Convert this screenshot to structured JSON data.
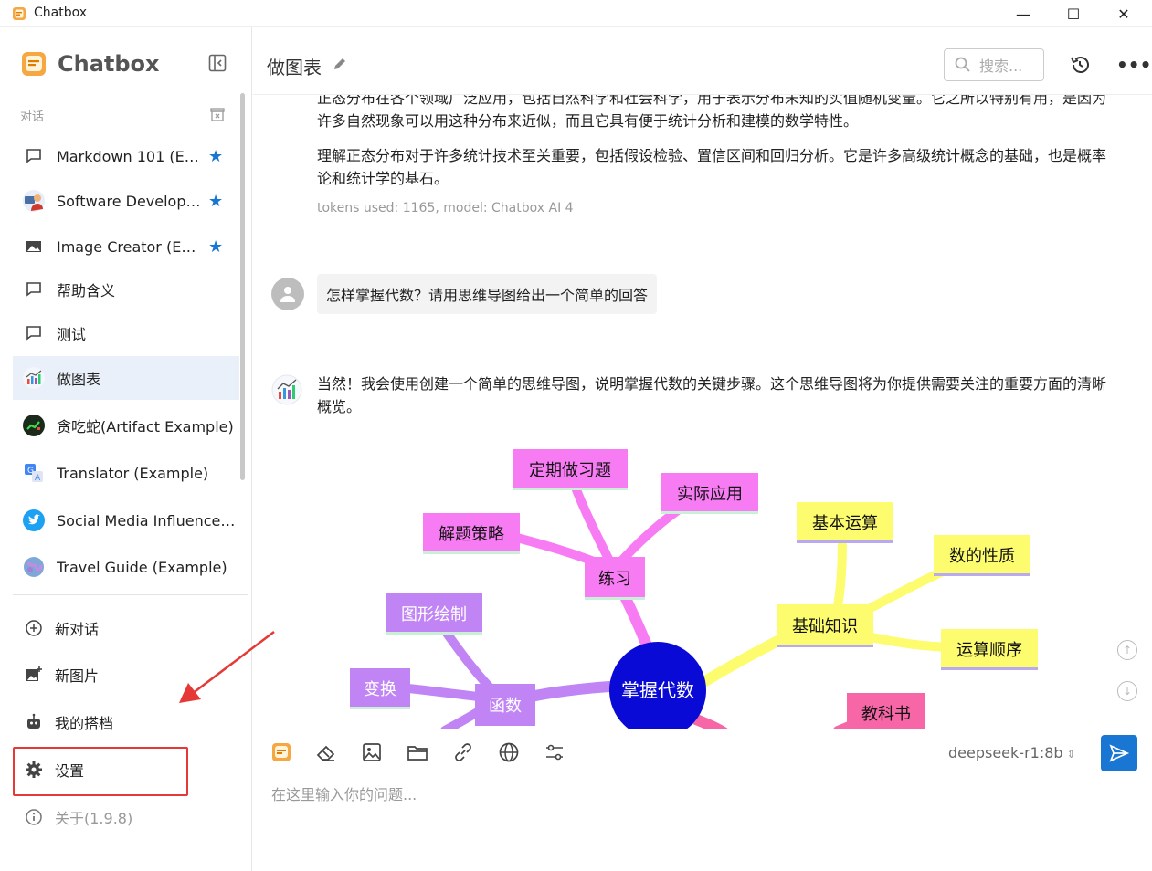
{
  "window": {
    "title": "Chatbox",
    "minimize": "—",
    "maximize": "☐",
    "close": "✕"
  },
  "sidebar": {
    "brand": "Chatbox",
    "section_label": "对话",
    "conversations": [
      {
        "label": "Markdown 101 (Ex…",
        "starred": true,
        "icon": "chat-bubble-icon"
      },
      {
        "label": "Software Develop…",
        "starred": true,
        "icon": "developer-avatar-icon"
      },
      {
        "label": "Image Creator (Ex…",
        "starred": true,
        "icon": "image-icon"
      },
      {
        "label": "帮助含义",
        "starred": false,
        "icon": "chat-bubble-icon"
      },
      {
        "label": "测试",
        "starred": false,
        "icon": "chat-bubble-icon"
      },
      {
        "label": "做图表",
        "starred": false,
        "icon": "chart-avatar-icon",
        "active": true
      },
      {
        "label": "贪吃蛇(Artifact Example)",
        "starred": false,
        "icon": "snake-game-icon"
      },
      {
        "label": "Translator (Example)",
        "starred": false,
        "icon": "translate-icon"
      },
      {
        "label": "Social Media Influencer …",
        "starred": false,
        "icon": "twitter-icon"
      },
      {
        "label": "Travel Guide (Example)",
        "starred": false,
        "icon": "globe-icon"
      }
    ],
    "star_glyph": "★",
    "nav": {
      "new_chat": "新对话",
      "new_image": "新图片",
      "my_partner": "我的搭档",
      "settings": "设置",
      "about": "关于(1.9.8)"
    }
  },
  "header": {
    "title": "做图表",
    "search_placeholder": "搜索...",
    "more": "•••"
  },
  "messages": {
    "prev_para1": "正态分布在各个领域广泛应用，包括自然科学和社会科学，用于表示分布未知的实值随机变量。它之所以特别有用，是因为许多自然现象可以用这种分布来近似，而且它具有便于统计分析和建模的数学特性。",
    "prev_para2": "理解正态分布对于许多统计技术至关重要，包括假设检验、置信区间和回归分析。它是许多高级统计概念的基础，也是概率论和统计学的基石。",
    "meta": "tokens used: 1165, model: Chatbox AI 4",
    "user_msg": "怎样掌握代数？请用思维导图给出一个简单的回答",
    "bot_msg": "当然！我会使用创建一个简单的思维导图，说明掌握代数的关键步骤。这个思维导图将为你提供需要关注的重要方面的清晰概览。"
  },
  "mindmap": {
    "root": "掌握代数",
    "nodes": {
      "practice": "练习",
      "regular": "定期做习题",
      "applied": "实际应用",
      "strategy": "解题策略",
      "basics": "基础知识",
      "ops": "基本运算",
      "props": "数的性质",
      "order": "运算顺序",
      "func": "函数",
      "graph": "图形绘制",
      "transform": "变换",
      "textbook": "教科书"
    },
    "colors": {
      "root": "#0a0ad6",
      "practice": "#f77cf3",
      "basics": "#fcfc6e",
      "func": "#c084f5",
      "resource": "#f766a6"
    }
  },
  "composer": {
    "model": "deepseek-r1:8b",
    "placeholder": "在这里输入你的问题..."
  }
}
